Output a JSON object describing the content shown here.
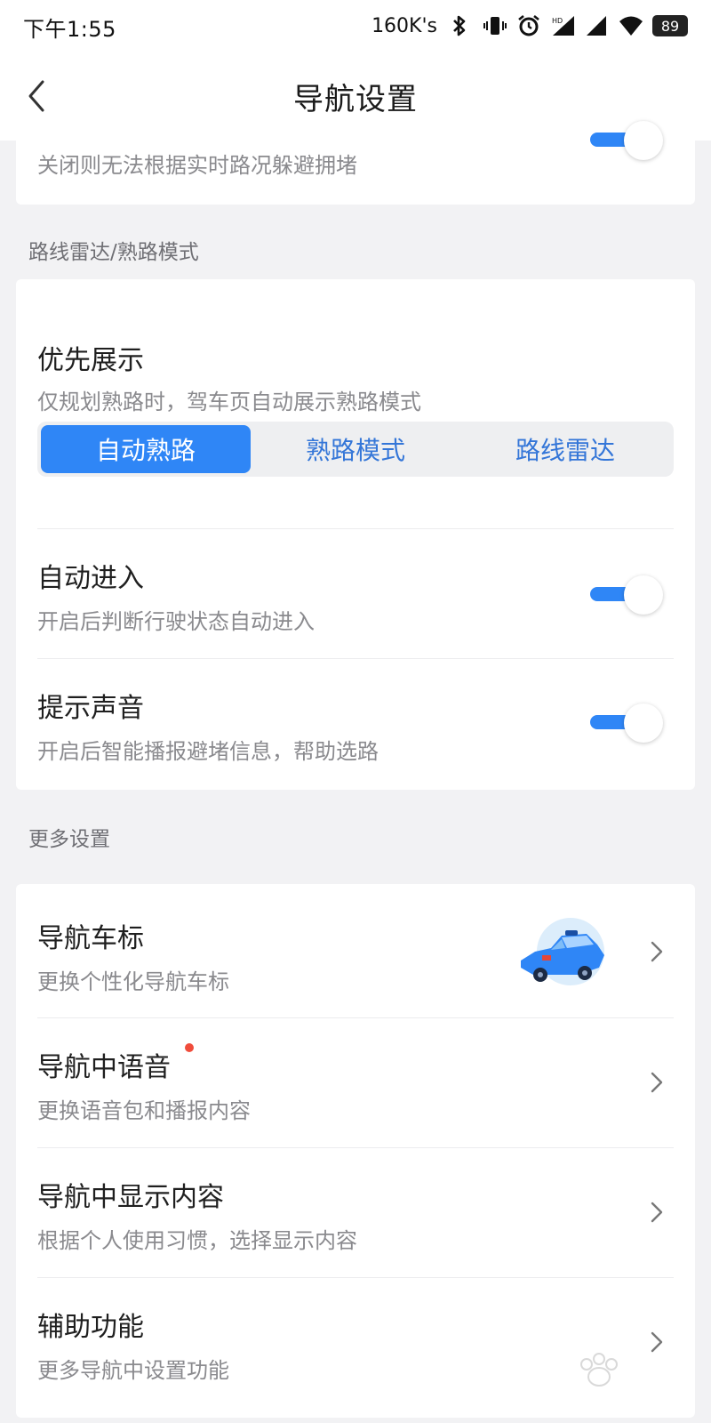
{
  "status_bar": {
    "time": "下午1:55",
    "speed": "160K's",
    "battery": "89",
    "icons": [
      "bluetooth-icon",
      "vibrate-icon",
      "alarm-icon",
      "signal-hd-icon",
      "signal-icon",
      "wifi-icon",
      "battery-icon"
    ]
  },
  "header": {
    "title": "导航设置",
    "back_icon": "back-chevron-icon"
  },
  "top_card": {
    "subtitle": "关闭则无法根据实时路况躲避拥堵",
    "toggle_on": true
  },
  "sections": {
    "route_radar": "路线雷达/熟路模式",
    "more_settings": "更多设置"
  },
  "priority": {
    "title": "优先展示",
    "subtitle": "仅规划熟路时，驾车页自动展示熟路模式",
    "options": [
      "自动熟路",
      "熟路模式",
      "路线雷达"
    ],
    "selected": "自动熟路"
  },
  "auto_enter": {
    "title": "自动进入",
    "subtitle": "开启后判断行驶状态自动进入",
    "toggle_on": true
  },
  "sound": {
    "title": "提示声音",
    "subtitle": "开启后智能播报避堵信息，帮助选路",
    "toggle_on": true
  },
  "more": [
    {
      "title": "导航车标",
      "subtitle": "更换个性化导航车标"
    },
    {
      "title": "导航中语音",
      "subtitle": "更换语音包和播报内容"
    },
    {
      "title": "导航中显示内容",
      "subtitle": "根据个人使用习惯，选择显示内容"
    },
    {
      "title": "辅助功能",
      "subtitle": "更多导航中设置功能"
    }
  ],
  "colors": {
    "accent": "#2f86f6",
    "badge": "#f04c3b",
    "background": "#f2f2f4"
  }
}
